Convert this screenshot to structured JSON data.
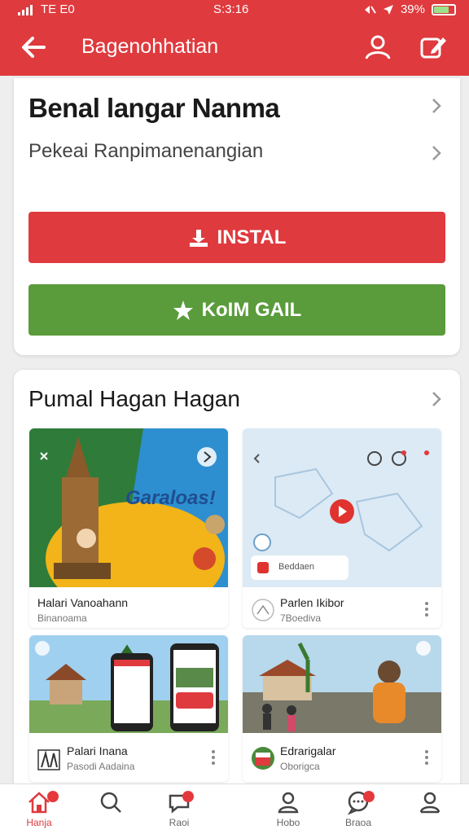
{
  "status_bar": {
    "left": "TE E0",
    "time": "S:3:16",
    "battery": "39%"
  },
  "app_bar": {
    "title": "Bagenohhatian"
  },
  "info_card": {
    "title": "Benal langar Nanma",
    "subtitle": "Pekeai Ranpimanenangian",
    "install_label": "INSTAL",
    "second_label": "KoIM GAIL"
  },
  "colors": {
    "accent_red": "#df3a3e",
    "green": "#5a9c3c",
    "badge": "#e5383b"
  },
  "section": {
    "title": "Pumal Hagan Hagan",
    "tiles": [
      {
        "title": "Halari Vanoahann",
        "subtitle": "Binanoama",
        "art_text": "Garaloas!"
      },
      {
        "title": "Parlen Ikibor",
        "subtitle": "7Boediva",
        "art_text": "Beddaen"
      },
      {
        "title": "Palari Inana",
        "subtitle": "Pasodi Aadaina"
      },
      {
        "title": "Edrarigalar",
        "subtitle": "Oborigca"
      }
    ]
  },
  "bottom_nav": {
    "items": [
      {
        "label": "Hanja",
        "icon": "home-icon"
      },
      {
        "label": "",
        "icon": "search-icon"
      },
      {
        "label": "Raoi",
        "icon": "chat-icon"
      },
      {
        "label": "Hobo",
        "icon": "person-icon"
      },
      {
        "label": "Braoa",
        "icon": "message-icon"
      },
      {
        "label": "",
        "icon": "profile-icon"
      }
    ]
  }
}
